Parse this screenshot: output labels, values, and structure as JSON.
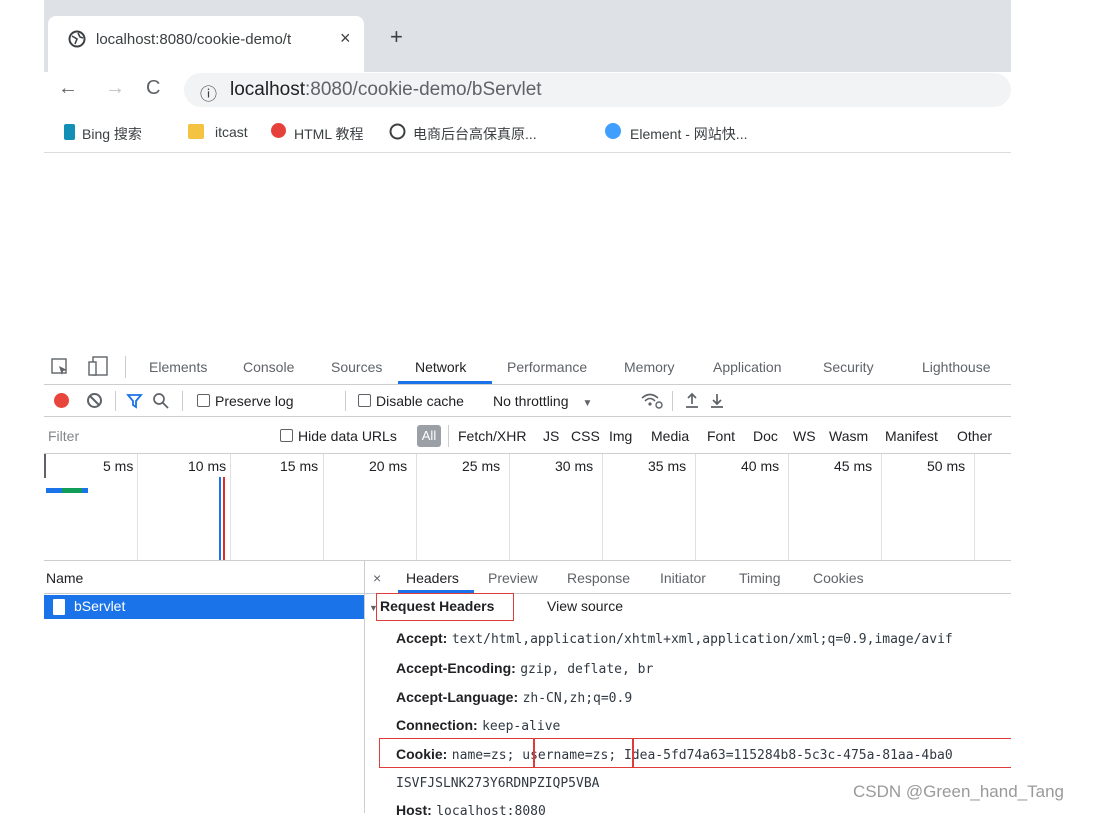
{
  "browser": {
    "tab_title": "localhost:8080/cookie-demo/t",
    "tab_close": "×",
    "new_tab": "+",
    "back": "←",
    "forward": "→",
    "reload": "C",
    "info": "ⓘ",
    "url_host": "localhost",
    "url_rest": ":8080/cookie-demo/bServlet",
    "bookmarks": [
      "Bing 搜索",
      "itcast",
      "HTML 教程",
      "电商后台高保真原...",
      "Element - 网站快..."
    ]
  },
  "devtools": {
    "tabs": [
      "Elements",
      "Console",
      "Sources",
      "Network",
      "Performance",
      "Memory",
      "Application",
      "Security",
      "Lighthouse"
    ],
    "active_tab": "Network",
    "toolbar": {
      "preserve_log": "Preserve log",
      "disable_cache": "Disable cache",
      "throttling": "No throttling"
    },
    "filter": {
      "placeholder": "Filter",
      "hide_data_urls": "Hide data URLs",
      "types": [
        "All",
        "Fetch/XHR",
        "JS",
        "CSS",
        "Img",
        "Media",
        "Font",
        "Doc",
        "WS",
        "Wasm",
        "Manifest",
        "Other"
      ]
    },
    "timeline_ticks": [
      "5 ms",
      "10 ms",
      "15 ms",
      "20 ms",
      "25 ms",
      "30 ms",
      "35 ms",
      "40 ms",
      "45 ms",
      "50 ms"
    ],
    "name_header": "Name",
    "requests": [
      "bServlet"
    ],
    "detail_tabs": [
      "×",
      "Headers",
      "Preview",
      "Response",
      "Initiator",
      "Timing",
      "Cookies"
    ],
    "request_headers_title": "Request Headers",
    "view_source": "View source",
    "headers": [
      {
        "key": "Accept:",
        "value": "text/html,application/xhtml+xml,application/xml;q=0.9,image/avif"
      },
      {
        "key": "Accept-Encoding:",
        "value": "gzip, deflate, br"
      },
      {
        "key": "Accept-Language:",
        "value": "zh-CN,zh;q=0.9"
      },
      {
        "key": "Connection:",
        "value": "keep-alive"
      },
      {
        "key": "Cookie:",
        "value": "name=zs; username=zs; Idea-5fd74a63=115284b8-5c3c-475a-81aa-4ba0"
      },
      {
        "key": "",
        "value": "ISVFJSLNK273Y6RDNPZIQP5VBA"
      },
      {
        "key": "Host:",
        "value": "localhost:8080"
      }
    ]
  },
  "watermark": "CSDN @Green_hand_Tang"
}
